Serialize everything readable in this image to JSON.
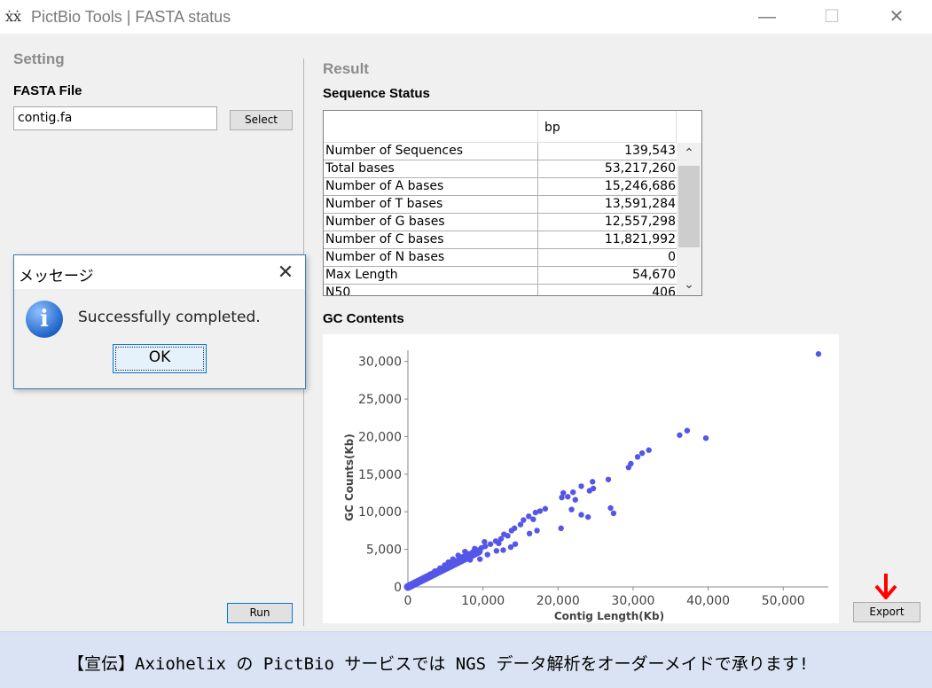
{
  "window": {
    "title": "PictBio Tools | FASTA status",
    "minimize": "—",
    "maximize": "☐",
    "close": "✕"
  },
  "setting": {
    "heading": "Setting",
    "fasta_label": "FASTA File",
    "fasta_value": "contig.fa",
    "select_label": "Select",
    "run_label": "Run"
  },
  "result": {
    "heading": "Result",
    "sequence_status_label": "Sequence Status",
    "table": {
      "headers": [
        "",
        "bp"
      ],
      "rows": [
        {
          "name": "Number of Sequences",
          "value": "139,543"
        },
        {
          "name": "Total bases",
          "value": "53,217,260"
        },
        {
          "name": "Number of A bases",
          "value": "15,246,686"
        },
        {
          "name": "Number of T bases",
          "value": "13,591,284"
        },
        {
          "name": "Number of G bases",
          "value": "12,557,298"
        },
        {
          "name": "Number of C bases",
          "value": "11,821,992"
        },
        {
          "name": "Number of N bases",
          "value": "0"
        },
        {
          "name": "Max Length",
          "value": "54,670"
        },
        {
          "name": "N50",
          "value": "406"
        }
      ]
    },
    "gc_label": "GC Contents",
    "export_label": "Export"
  },
  "dialog": {
    "title": "メッセージ",
    "message": "Successfully completed.",
    "ok_label": "OK",
    "close": "✕"
  },
  "banner": {
    "text": "【宣伝】Axiohelix の PictBio サービスでは NGS データ解析をオーダーメイドで承ります!"
  },
  "colors": {
    "point": "#5456e8",
    "arrow": "#ff0000"
  },
  "chart_data": {
    "type": "scatter",
    "xlabel": "Contig Length(Kb)",
    "ylabel": "GC Counts(Kb)",
    "xlim": [
      0,
      56000
    ],
    "ylim": [
      0,
      31500
    ],
    "xticks": [
      "0",
      "10,000",
      "20,000",
      "30,000",
      "40,000",
      "50,000"
    ],
    "yticks": [
      "0",
      "5,000",
      "10,000",
      "15,000",
      "20,000",
      "25,000",
      "30,000"
    ],
    "points": [
      [
        54700,
        31000
      ],
      [
        37200,
        20800
      ],
      [
        36200,
        20200
      ],
      [
        39700,
        19800
      ],
      [
        32100,
        18200
      ],
      [
        31200,
        17800
      ],
      [
        30600,
        17300
      ],
      [
        29700,
        16400
      ],
      [
        29400,
        15900
      ],
      [
        26700,
        14300
      ],
      [
        24600,
        14000
      ],
      [
        24700,
        13100
      ],
      [
        23100,
        13400
      ],
      [
        24200,
        12800
      ],
      [
        22000,
        12600
      ],
      [
        20700,
        12500
      ],
      [
        21300,
        12000
      ],
      [
        20500,
        11900
      ],
      [
        22300,
        11600
      ],
      [
        27000,
        10500
      ],
      [
        27400,
        9800
      ],
      [
        23100,
        9600
      ],
      [
        24000,
        9300
      ],
      [
        21800,
        10300
      ],
      [
        20400,
        7800
      ],
      [
        17600,
        10100
      ],
      [
        18300,
        10400
      ],
      [
        17000,
        9900
      ],
      [
        16100,
        9400
      ],
      [
        16700,
        9000
      ],
      [
        15400,
        8900
      ],
      [
        15000,
        8300
      ],
      [
        17200,
        7500
      ],
      [
        16200,
        7100
      ],
      [
        13800,
        7500
      ],
      [
        14200,
        7800
      ],
      [
        12800,
        7000
      ],
      [
        13300,
        6800
      ],
      [
        12400,
        6400
      ],
      [
        11700,
        6100
      ],
      [
        12100,
        5800
      ],
      [
        11000,
        5700
      ],
      [
        10300,
        5400
      ],
      [
        9800,
        5200
      ],
      [
        9400,
        4900
      ],
      [
        9000,
        4700
      ],
      [
        8600,
        4600
      ],
      [
        8100,
        4400
      ],
      [
        7700,
        4200
      ],
      [
        7300,
        4000
      ],
      [
        6900,
        3800
      ],
      [
        6600,
        3500
      ],
      [
        6200,
        3300
      ],
      [
        5900,
        3100
      ],
      [
        5500,
        2900
      ],
      [
        5200,
        2700
      ],
      [
        4800,
        2500
      ],
      [
        4500,
        2300
      ],
      [
        4200,
        2100
      ],
      [
        3800,
        1900
      ],
      [
        3500,
        1800
      ],
      [
        3100,
        1600
      ],
      [
        2800,
        1400
      ],
      [
        2500,
        1200
      ],
      [
        2100,
        1050
      ],
      [
        1800,
        900
      ],
      [
        1500,
        750
      ],
      [
        1200,
        600
      ],
      [
        900,
        450
      ],
      [
        600,
        300
      ],
      [
        300,
        150
      ],
      [
        10600,
        4300
      ],
      [
        9600,
        3700
      ],
      [
        8300,
        3600
      ],
      [
        11800,
        4800
      ],
      [
        12700,
        4900
      ],
      [
        13700,
        5300
      ],
      [
        14300,
        5700
      ],
      [
        10200,
        6000
      ],
      [
        8900,
        5100
      ],
      [
        7600,
        4700
      ],
      [
        6700,
        4200
      ],
      [
        6000,
        3700
      ],
      [
        5400,
        3300
      ],
      [
        4900,
        2900
      ],
      [
        4300,
        2500
      ],
      [
        3600,
        2100
      ],
      [
        3000,
        1700
      ],
      [
        2400,
        1350
      ],
      [
        1900,
        1050
      ]
    ]
  }
}
